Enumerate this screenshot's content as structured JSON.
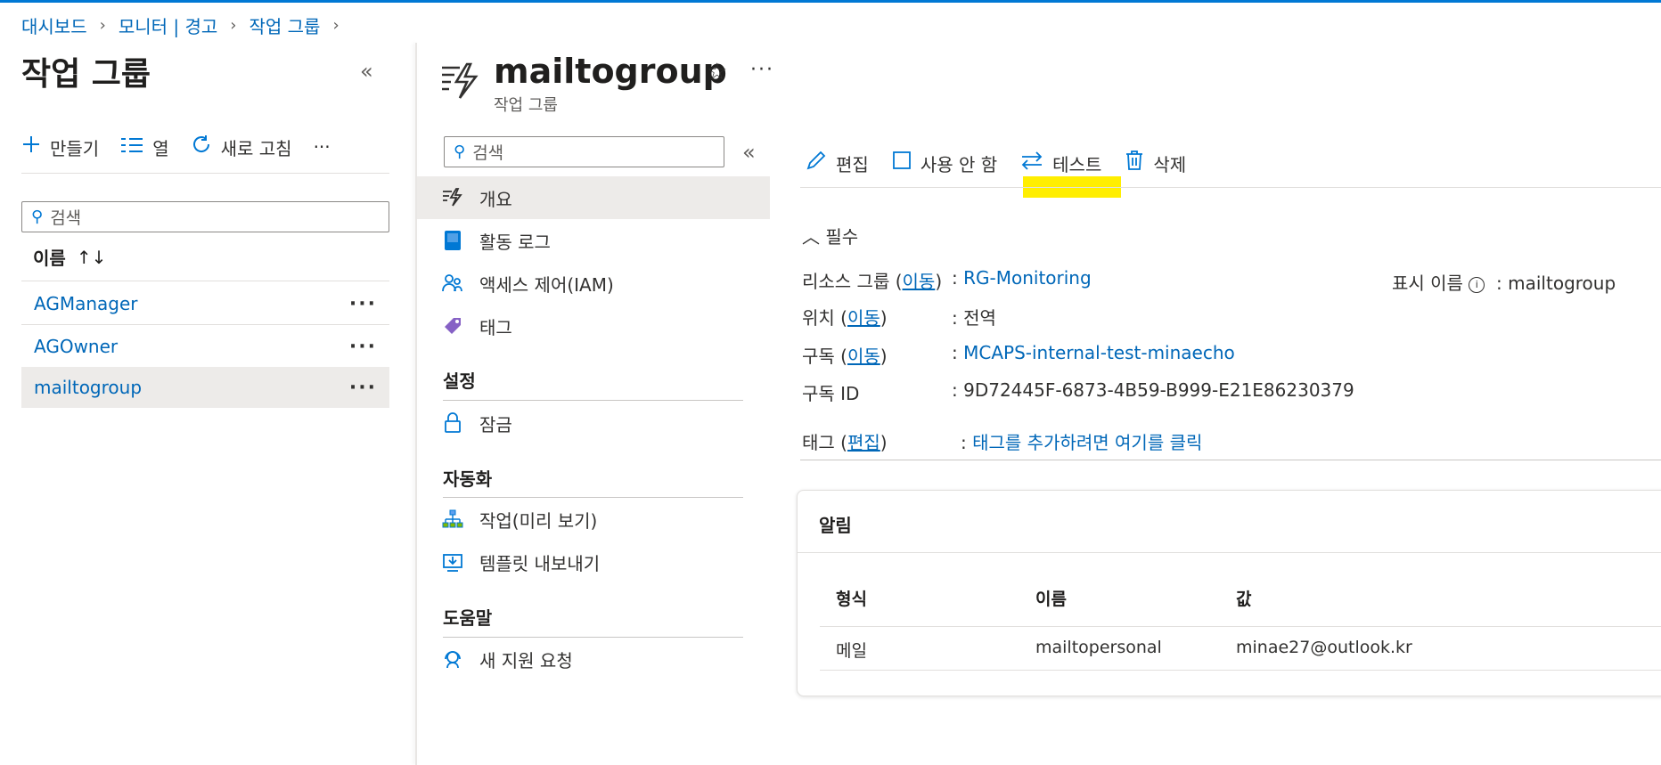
{
  "breadcrumb": [
    "대시보드",
    "모니터 | 경고",
    "작업 그룹"
  ],
  "left_blade": {
    "title": "작업 그룹",
    "commands": [
      {
        "icon": "plus-icon",
        "label": "만들기"
      },
      {
        "icon": "columns-icon",
        "label": "열"
      },
      {
        "icon": "refresh-icon",
        "label": "새로 고침"
      }
    ],
    "more": "···",
    "search_placeholder": "검색",
    "column_header": "이름",
    "sort_glyph": "↑↓",
    "rows": [
      "AGManager",
      "AGOwner",
      "mailtogroup"
    ],
    "selected": "mailtogroup"
  },
  "resource": {
    "name": "mailtogroup",
    "type": "작업 그룹",
    "search_placeholder": "검색",
    "nav": {
      "top": [
        {
          "icon": "overview-icon",
          "label": "개요"
        },
        {
          "icon": "activity-log-icon",
          "label": "활동 로그"
        },
        {
          "icon": "iam-icon",
          "label": "액세스 제어(IAM)"
        },
        {
          "icon": "tag-icon",
          "label": "태그"
        }
      ],
      "sections": [
        {
          "title": "설정",
          "items": [
            {
              "icon": "lock-icon",
              "label": "잠금"
            }
          ]
        },
        {
          "title": "자동화",
          "items": [
            {
              "icon": "tasks-icon",
              "label": "작업(미리 보기)"
            },
            {
              "icon": "export-template-icon",
              "label": "템플릿 내보내기"
            }
          ]
        },
        {
          "title": "도움말",
          "items": [
            {
              "icon": "support-icon",
              "label": "새 지원 요청"
            }
          ]
        }
      ]
    }
  },
  "toolbar": {
    "edit": "편집",
    "disable": "사용 안 함",
    "test": "테스트",
    "delete": "삭제"
  },
  "essentials": {
    "toggle": "필수",
    "rg_label": "리소스 그룹",
    "move": "이동",
    "rg_value": "RG-Monitoring",
    "location_label": "위치",
    "location_value": "전역",
    "subscription_label": "구독",
    "subscription_value": "MCAPS-internal-test-minaecho",
    "subscription_id_label": "구독 ID",
    "subscription_id_value": "9D72445F-6873-4B59-B999-E21E86230379",
    "tags_label": "태그",
    "tags_edit": "편집",
    "tags_value": "태그를 추가하려면 여기를 클릭",
    "display_name_label": "표시 이름",
    "display_name_value": "mailtogroup"
  },
  "notifications": {
    "title": "알림",
    "headers": [
      "형식",
      "이름",
      "값"
    ],
    "rows": [
      [
        "메일",
        "mailtopersonal",
        "minae27@outlook.kr"
      ]
    ]
  },
  "colors": {
    "accent": "#0078d4",
    "link": "#0067b8",
    "highlight": "#ffee00",
    "selected_bg": "#edebe9"
  }
}
